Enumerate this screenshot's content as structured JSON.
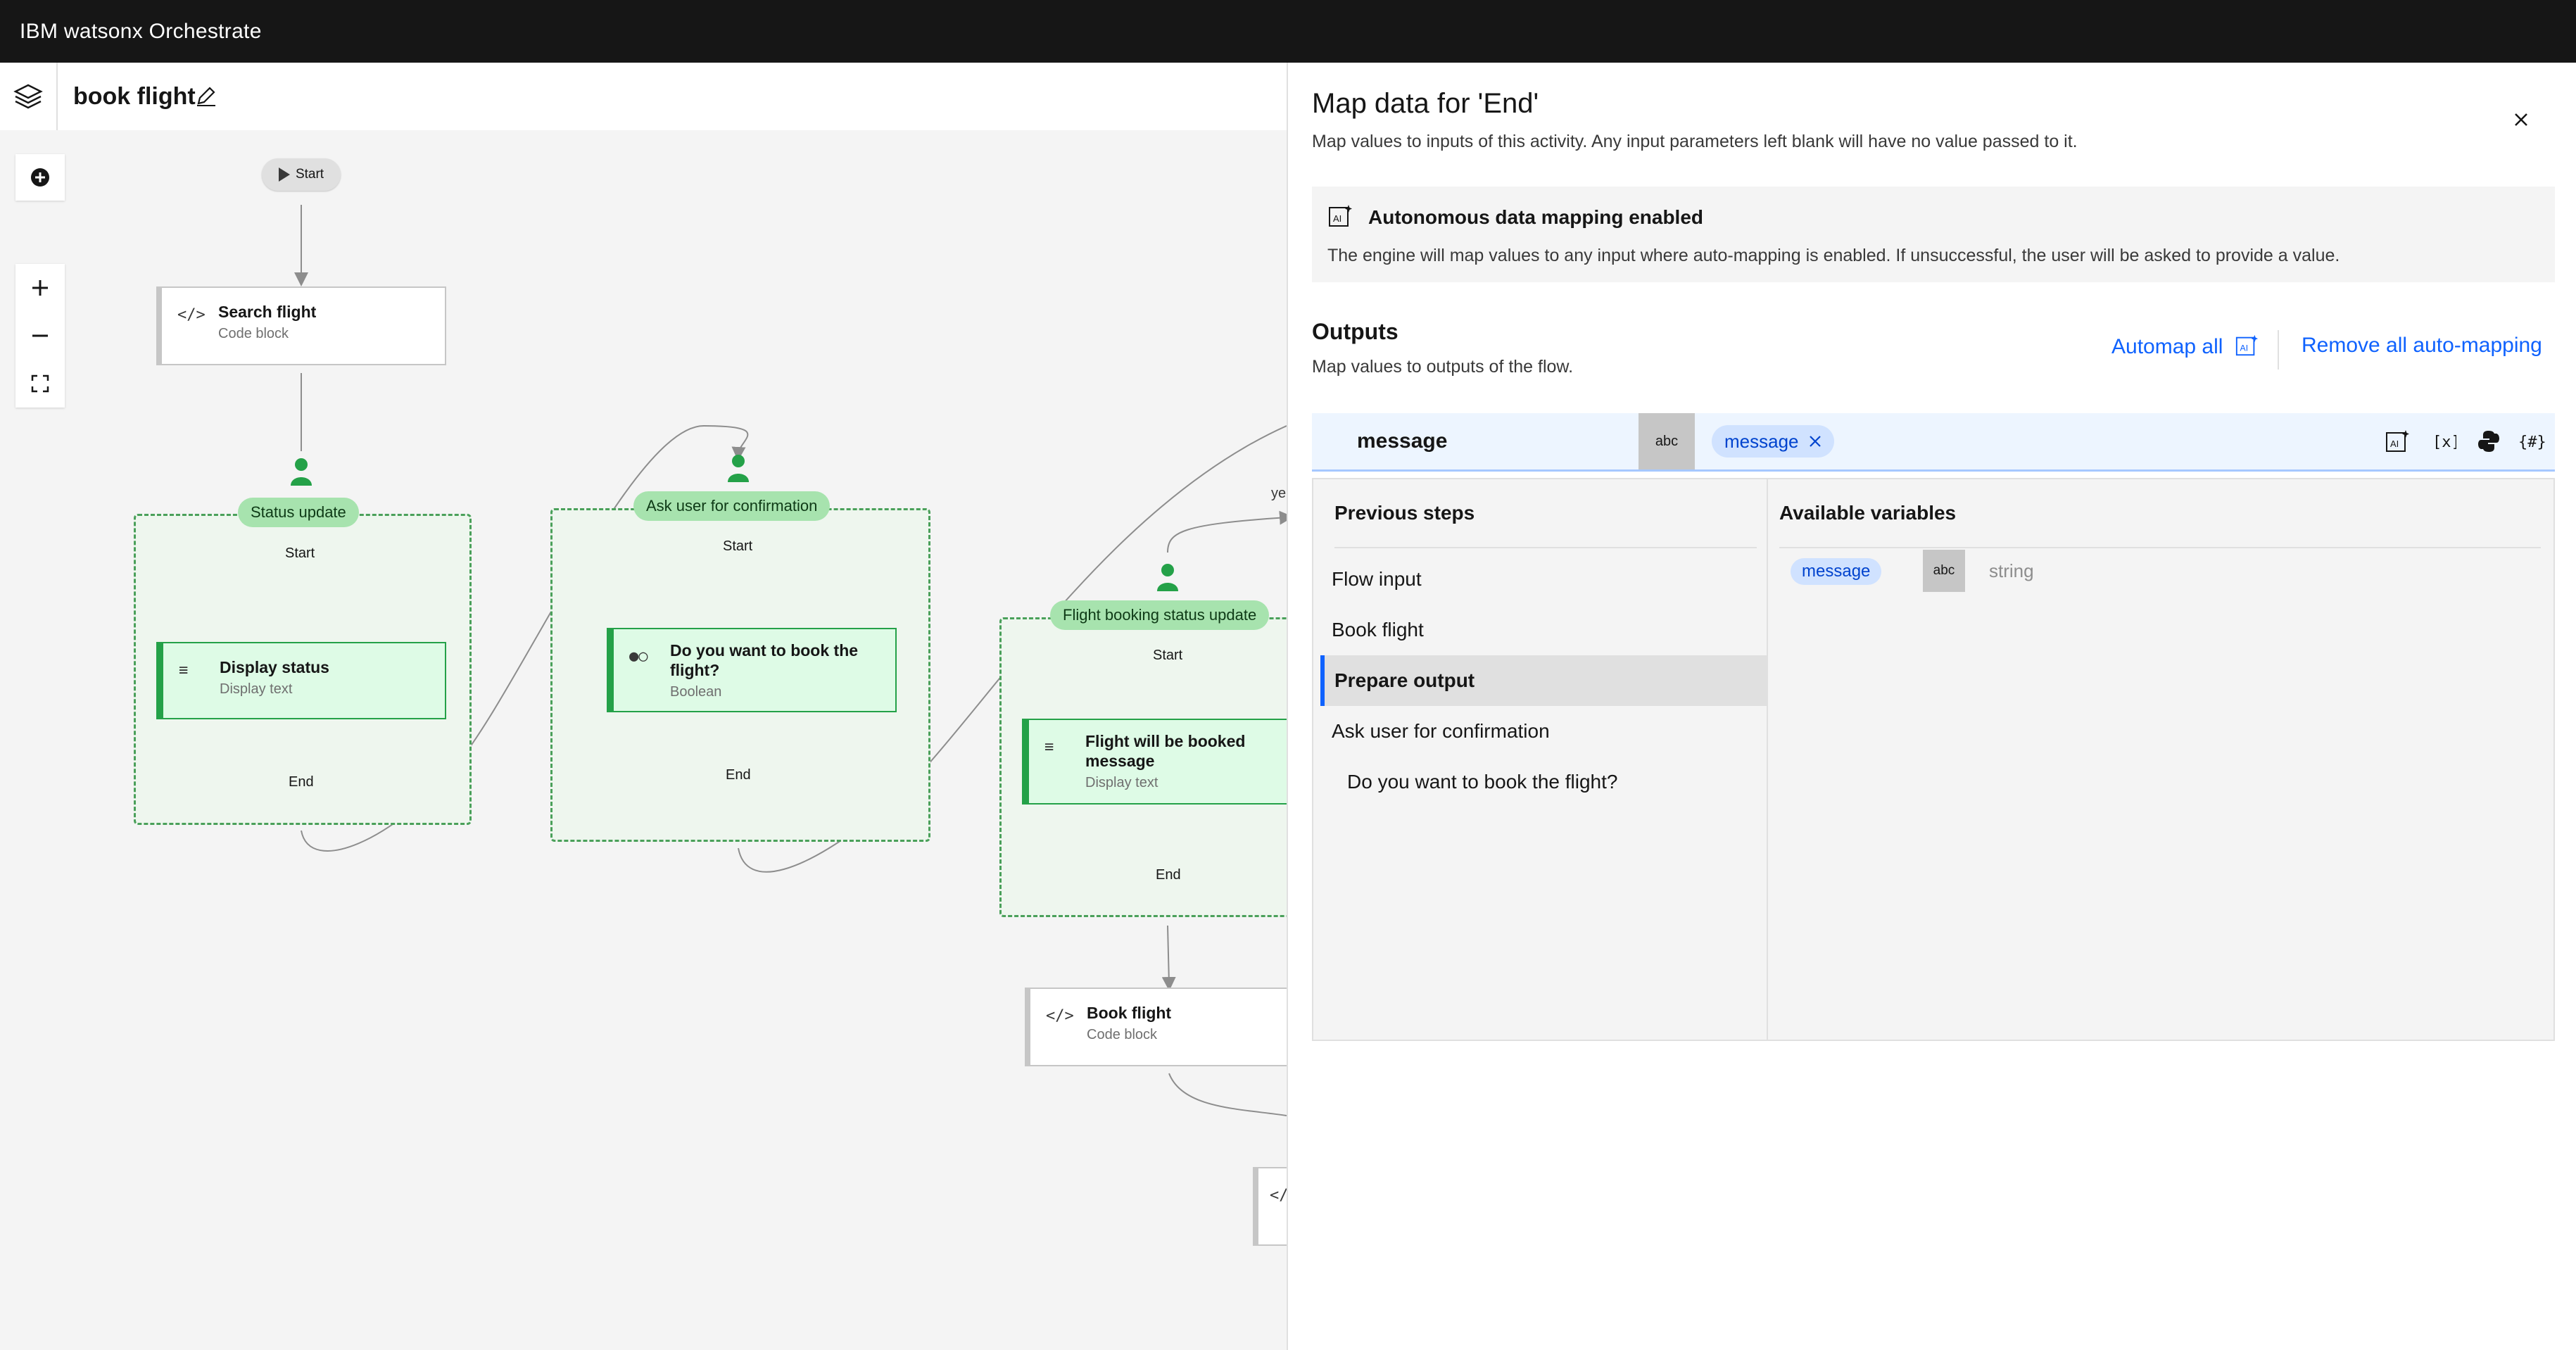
{
  "app": {
    "title": "IBM watsonx Orchestrate"
  },
  "flow": {
    "name": "book flight"
  },
  "canvas": {
    "start_label": "Start",
    "groups": [
      {
        "title": "Status update",
        "start": "Start",
        "end": "End"
      },
      {
        "title": "Ask user for confirmation",
        "start": "Start",
        "end": "End"
      },
      {
        "title": "Flight booking status update",
        "start": "Start",
        "end": "End"
      }
    ],
    "nodes": {
      "search_flight": {
        "title": "Search flight",
        "subtitle": "Code block"
      },
      "display_status": {
        "title": "Display status",
        "subtitle": "Display text"
      },
      "confirm": {
        "title": "Do you want to book the flight?",
        "subtitle": "Boolean"
      },
      "booked_msg": {
        "title": "Flight will be booked message",
        "subtitle": "Display text"
      },
      "book_flight": {
        "title": "Book flight",
        "subtitle": "Code block"
      }
    },
    "edge_label": "ye"
  },
  "panel": {
    "title": "Map data for 'End'",
    "description": "Map values to inputs of this activity. Any input parameters left blank will have no value passed to it.",
    "notice": {
      "title": "Autonomous data mapping enabled",
      "text": "The engine will map values to any input where auto-mapping is enabled. If unsuccessful, the user will be asked to provide a value."
    },
    "outputs": {
      "title": "Outputs",
      "description": "Map values to outputs of the flow.",
      "automap_all": "Automap all",
      "remove_all": "Remove all auto-mapping"
    },
    "mapping": {
      "field": "message",
      "type_badge": "abc",
      "value_tag": "message"
    },
    "picker": {
      "previous_steps_header": "Previous steps",
      "available_vars_header": "Available variables",
      "steps": [
        "Flow input",
        "Book flight",
        "Prepare output",
        "Ask user for confirmation"
      ],
      "selected_step": "Prepare output",
      "substep": "Do you want to book the flight?",
      "variables": [
        {
          "name": "message",
          "type_badge": "abc",
          "type": "string"
        }
      ]
    }
  },
  "colors": {
    "accent": "#0f62fe",
    "group_green": "#24a148",
    "topbar": "#161616"
  }
}
